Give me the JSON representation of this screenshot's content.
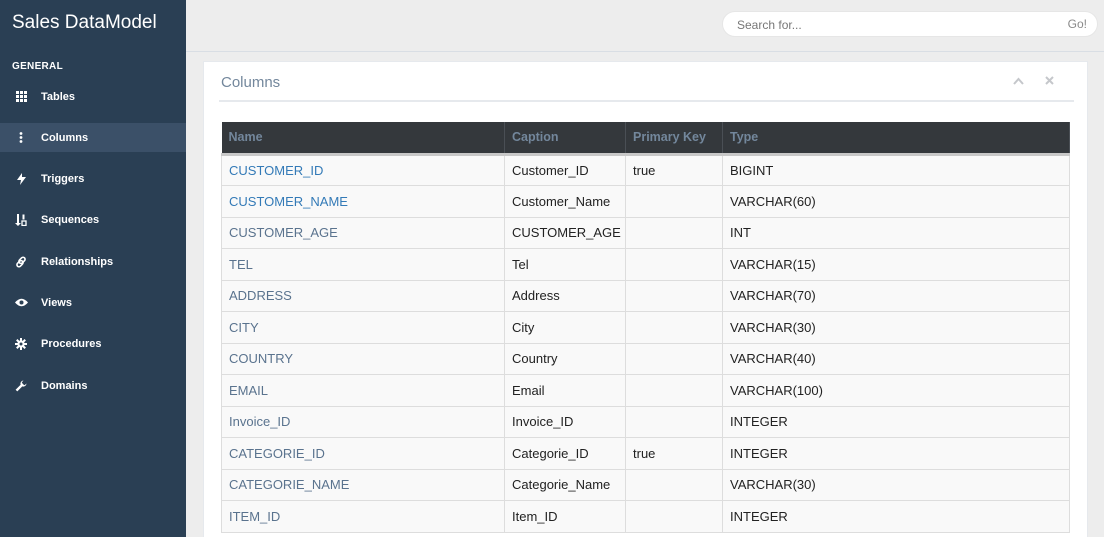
{
  "app": {
    "title": "Sales DataModel"
  },
  "sidebar": {
    "section_title": "GENERAL",
    "items": [
      {
        "label": "Tables",
        "icon": "grid-icon",
        "active": false
      },
      {
        "label": "Columns",
        "icon": "ellipsis-vertical-icon",
        "active": true
      },
      {
        "label": "Triggers",
        "icon": "bolt-icon",
        "active": false
      },
      {
        "label": "Sequences",
        "icon": "sort-numeric-icon",
        "active": false
      },
      {
        "label": "Relationships",
        "icon": "link-icon",
        "active": false
      },
      {
        "label": "Views",
        "icon": "eye-icon",
        "active": false
      },
      {
        "label": "Procedures",
        "icon": "cog-icon",
        "active": false
      },
      {
        "label": "Domains",
        "icon": "wrench-icon",
        "active": false
      }
    ]
  },
  "search": {
    "placeholder": "Search for...",
    "button_label": "Go!"
  },
  "panel": {
    "title": "Columns",
    "collapse_icon": "chevron-up-icon",
    "close_icon": "close-icon"
  },
  "table": {
    "headers": [
      "Name",
      "Caption",
      "Primary Key",
      "Type"
    ],
    "rows": [
      {
        "name": "CUSTOMER_ID",
        "caption": "Customer_ID",
        "primary_key": "true",
        "type": "BIGINT"
      },
      {
        "name": "CUSTOMER_NAME",
        "caption": "Customer_Name",
        "primary_key": "",
        "type": "VARCHAR(60)"
      },
      {
        "name": "CUSTOMER_AGE",
        "caption": "CUSTOMER_AGE",
        "primary_key": "",
        "type": "INT"
      },
      {
        "name": "TEL",
        "caption": "Tel",
        "primary_key": "",
        "type": "VARCHAR(15)"
      },
      {
        "name": "ADDRESS",
        "caption": "Address",
        "primary_key": "",
        "type": "VARCHAR(70)"
      },
      {
        "name": "CITY",
        "caption": "City",
        "primary_key": "",
        "type": "VARCHAR(30)"
      },
      {
        "name": "COUNTRY",
        "caption": "Country",
        "primary_key": "",
        "type": "VARCHAR(40)"
      },
      {
        "name": "EMAIL",
        "caption": "Email",
        "primary_key": "",
        "type": "VARCHAR(100)"
      },
      {
        "name": "Invoice_ID",
        "caption": "Invoice_ID",
        "primary_key": "",
        "type": "INTEGER"
      },
      {
        "name": "CATEGORIE_ID",
        "caption": "Categorie_ID",
        "primary_key": "true",
        "type": "INTEGER"
      },
      {
        "name": "CATEGORIE_NAME",
        "caption": "Categorie_Name",
        "primary_key": "",
        "type": "VARCHAR(30)"
      },
      {
        "name": "ITEM_ID",
        "caption": "Item_ID",
        "primary_key": "",
        "type": "INTEGER"
      }
    ]
  },
  "colors": {
    "sidebar_bg": "#2a3f54",
    "sidebar_active": "#3b5068",
    "table_header_bg": "#34383c",
    "link": "#337ab7",
    "name_text": "#5a738e"
  }
}
